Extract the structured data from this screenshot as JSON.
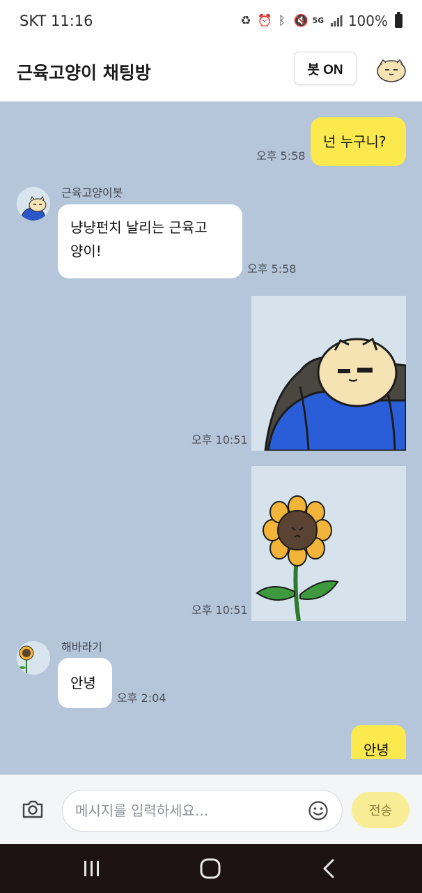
{
  "status_bar": {
    "carrier_time": "SKT 11:16",
    "battery": "100%",
    "network": "5G"
  },
  "header": {
    "title": "근육고양이 채팅방",
    "bot_toggle_label": "봇 ON"
  },
  "messages": [
    {
      "from": "me",
      "text": "넌 누구니?",
      "time": "오후 5:58"
    },
    {
      "from": "them",
      "sender": "근육고양이봇",
      "text_line1": "냥냥펀치 날리는 근육고",
      "text_line2": "양이!",
      "time": "오후 5:58"
    },
    {
      "from": "me",
      "type": "image",
      "image": "muscle-cat-sticker",
      "time": "오후 10:51"
    },
    {
      "from": "me",
      "type": "image",
      "image": "sunflower-sticker",
      "time": "오후 10:51"
    },
    {
      "from": "them",
      "sender": "해바라기",
      "text": "안녕",
      "time": "오후 2:04"
    },
    {
      "from": "me",
      "text": "안녕"
    }
  ],
  "input": {
    "placeholder": "메시지를 입력하세요...",
    "send_label": "전송"
  },
  "colors": {
    "chat_bg": "#b6c6da",
    "my_bubble": "#fbe94e",
    "their_bubble": "#ffffff",
    "send_button": "#f8ed94",
    "nav_bg": "#1d1313"
  }
}
